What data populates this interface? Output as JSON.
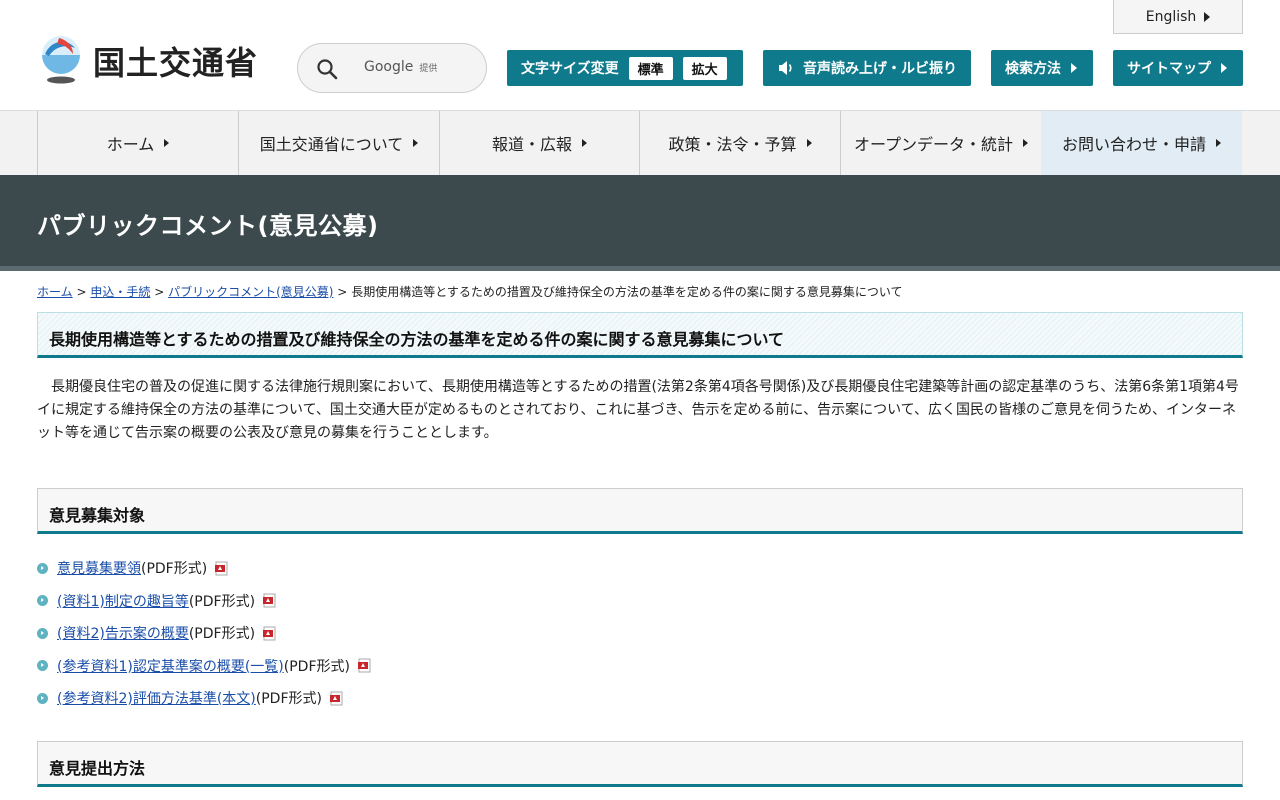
{
  "header": {
    "logo_text": "国土交通省",
    "search": {
      "brand": "Google",
      "provided": "提供"
    },
    "english_label": "English",
    "fontsize": {
      "label": "文字サイズ変更",
      "standard": "標準",
      "large": "拡大"
    },
    "voice_label": "音声読み上げ・ルビ振り",
    "howto_label": "検索方法",
    "sitemap_label": "サイトマップ"
  },
  "gnav": {
    "items": [
      {
        "label": "ホーム"
      },
      {
        "label": "国土交通省について"
      },
      {
        "label": "報道・広報"
      },
      {
        "label": "政策・法令・予算"
      },
      {
        "label": "オープンデータ・統計"
      },
      {
        "label": "お問い合わせ・申請"
      }
    ]
  },
  "page": {
    "banner_title": "パブリックコメント(意見公募)",
    "breadcrumb": {
      "items": [
        "ホーム",
        "申込・手続",
        "パブリックコメント(意見公募)"
      ],
      "current": "長期使用構造等とするための措置及び維持保全の方法の基準を定める件の案に関する意見募集について",
      "separator": ">"
    },
    "title": "長期使用構造等とするための措置及び維持保全の方法の基準を定める件の案に関する意見募集について",
    "lead": "長期優良住宅の普及の促進に関する法律施行規則案において、長期使用構造等とするための措置(法第2条第4項各号関係)及び長期優良住宅建築等計画の認定基準のうち、法第6条第1項第4号イに規定する維持保全の方法の基準について、国土交通大臣が定めるものとされており、これに基づき、告示を定める前に、告示案について、広く国民の皆様のご意見を伺うため、インターネット等を通じて告示案の概要の公表及び意見の募集を行うこととします。",
    "sections": [
      {
        "heading": "意見募集対象"
      },
      {
        "heading": "意見提出方法"
      }
    ],
    "documents": [
      {
        "link": "意見募集要領",
        "format": "(PDF形式)"
      },
      {
        "link": "(資料1)制定の趣旨等",
        "format": "(PDF形式)"
      },
      {
        "link": "(資料2)告示案の概要",
        "format": "(PDF形式)"
      },
      {
        "link": "(参考資料1)認定基準案の概要(一覧)",
        "format": "(PDF形式)"
      },
      {
        "link": "(参考資料2)評価方法基準(本文)",
        "format": "(PDF形式)"
      }
    ]
  },
  "colors": {
    "accent": "#0e7a8c",
    "banner": "#3c4a4e",
    "link": "#1a4ea8"
  }
}
